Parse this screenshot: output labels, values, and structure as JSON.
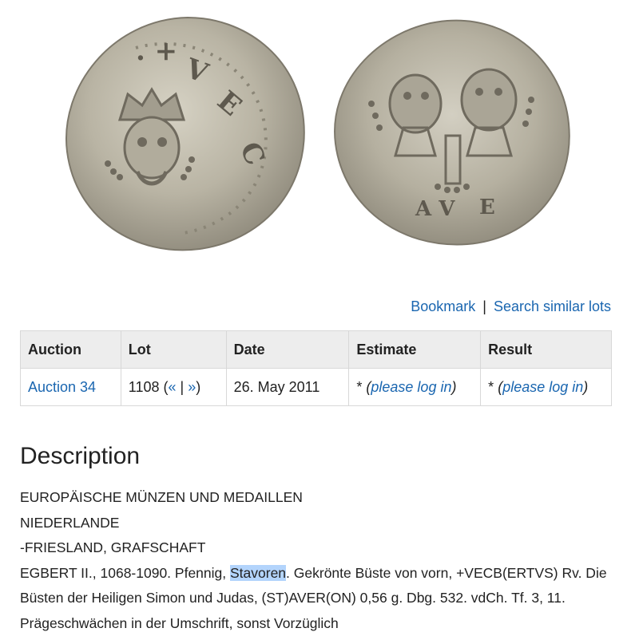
{
  "links": {
    "bookmark": "Bookmark",
    "separator": "|",
    "search_similar": "Search similar lots"
  },
  "table": {
    "headers": {
      "auction": "Auction",
      "lot": "Lot",
      "date": "Date",
      "estimate": "Estimate",
      "result": "Result"
    },
    "row": {
      "auction": "Auction 34",
      "lot_number": "1108",
      "lot_open": "(",
      "prev": "«",
      "lot_sep": " | ",
      "next": "»",
      "lot_close": ")",
      "date": "26. May 2011",
      "estimate_star": "*",
      "estimate_login": "please log in",
      "result_star": "*",
      "result_login": "please log in"
    }
  },
  "description": {
    "title": "Description",
    "line1": "EUROPÄISCHE MÜNZEN UND MEDAILLEN",
    "line2": "NIEDERLANDE",
    "line3": "-FRIESLAND, GRAFSCHAFT",
    "line4_pre": "EGBERT II., 1068-1090. Pfennig, ",
    "line4_highlight": "Stavoren",
    "line4_post": ". Gekrönte Büste von vorn, +VECB(ERTVS) Rv. Die Büsten der Heiligen Simon und Judas, (ST)AVER(ON) 0,56 g. Dbg. 532. vdCh. Tf. 3, 11. Prägeschwächen in der Umschrift, sonst Vorzüglich"
  },
  "colors": {
    "link": "#1a66b0",
    "header_bg": "#ededed",
    "highlight": "#b3d4fc",
    "coin_silver": "#b8b3a3"
  },
  "icons": {
    "obverse": "coin-obverse-image",
    "reverse": "coin-reverse-image"
  }
}
